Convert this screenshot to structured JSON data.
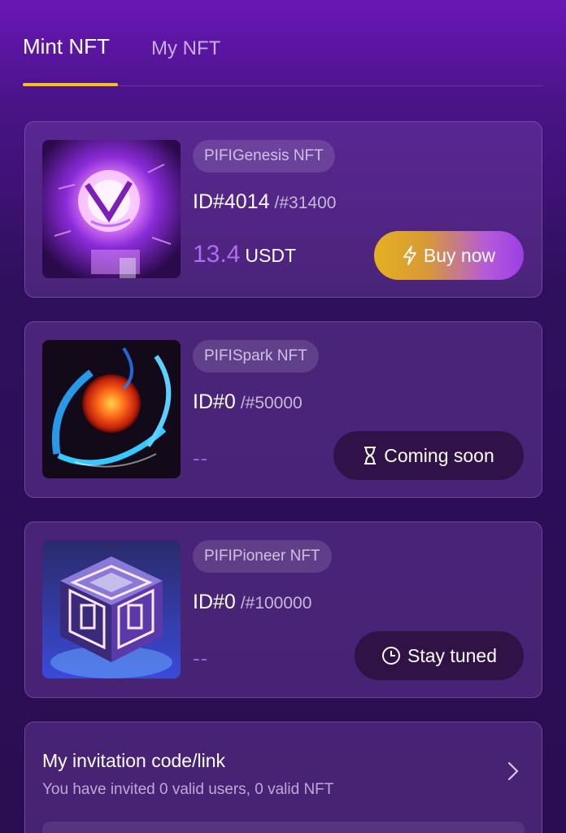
{
  "tabs": [
    {
      "label": "Mint NFT",
      "active": true
    },
    {
      "label": "My NFT",
      "active": false
    }
  ],
  "cards": [
    {
      "tag": "PIFIGenesis NFT",
      "id": "ID#4014",
      "total": "/#31400",
      "price_value": "13.4",
      "price_unit": "USDT",
      "button_label": "Buy now",
      "button_icon": "lightning-icon",
      "image_icon": "glowing-sphere-artwork"
    },
    {
      "tag": "PIFISpark NFT",
      "id": "ID#0",
      "total": "/#50000",
      "price_placeholder": "--",
      "button_label": "Coming soon",
      "button_icon": "hourglass-icon",
      "image_icon": "ringed-planet-artwork"
    },
    {
      "tag": "PIFIPioneer NFT",
      "id": "ID#0",
      "total": "/#100000",
      "price_placeholder": "--",
      "button_label": "Stay tuned",
      "button_icon": "clock-icon",
      "image_icon": "glowing-cube-artwork"
    }
  ],
  "invitation": {
    "title": "My invitation code/link",
    "subtitle": "You have invited 0 valid users, 0 valid NFT",
    "chevron_icon": "chevron-right-icon"
  },
  "colors": {
    "accent_underline": "#f4c01e",
    "price_purple": "#b16cf2",
    "buy_gradient_start": "#e5b021",
    "buy_gradient_end": "#9b3fe6"
  }
}
